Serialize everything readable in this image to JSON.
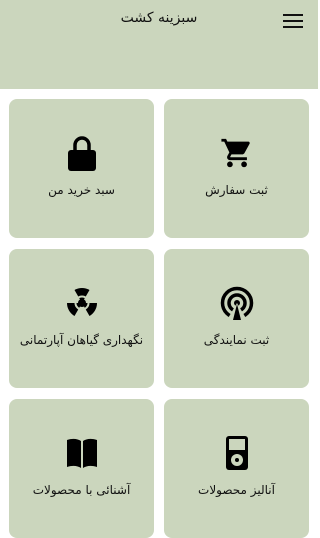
{
  "app": {
    "title": "سبزینه کشت"
  },
  "tiles": [
    {
      "id": "order",
      "label": "ثبت سفارش",
      "icon": "shopping-cart-icon"
    },
    {
      "id": "cart",
      "label": "سبد خرید من",
      "icon": "lock-icon"
    },
    {
      "id": "agency",
      "label": "ثبت نمایندگی",
      "icon": "broadcast-icon"
    },
    {
      "id": "care",
      "label": "نگهداری گیاهان آپارتمانی",
      "icon": "radiation-icon"
    },
    {
      "id": "analysis",
      "label": "آنالیز محصولات",
      "icon": "device-icon"
    },
    {
      "id": "intro",
      "label": "آشنائی با محصولات",
      "icon": "book-icon"
    }
  ],
  "colors": {
    "tile": "#cbd6bd",
    "header": "#cbd6bd",
    "text": "#111111"
  }
}
